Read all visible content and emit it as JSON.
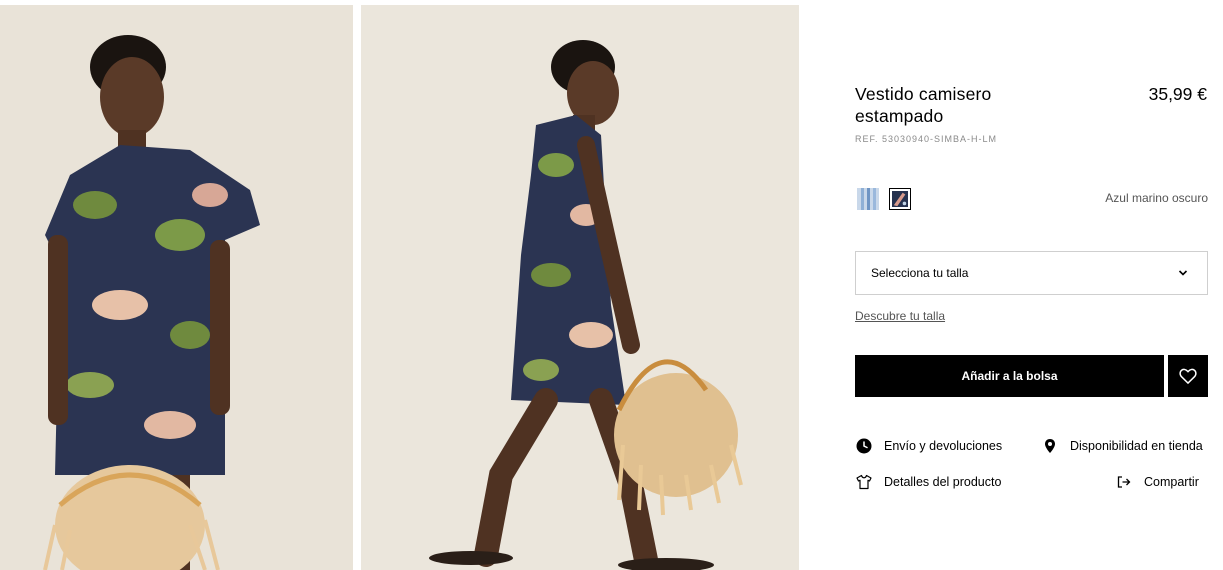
{
  "gallery": {
    "images": [
      {
        "alt": "front-view-photo"
      },
      {
        "alt": "side-view-photo"
      }
    ]
  },
  "product": {
    "title": "Vestido camisero estampado",
    "price": "35,99 €",
    "ref": "REF. 53030940-SIMBA-H-LM"
  },
  "colors": {
    "selected_name": "Azul marino oscuro",
    "swatches": [
      {
        "name": "light-blue-stripe",
        "color": "#8fb0d6"
      },
      {
        "name": "navy-print",
        "color": "#26324f",
        "selected": true
      }
    ]
  },
  "size": {
    "placeholder": "Selecciona tu talla",
    "guide_link": "Descubre tu talla"
  },
  "actions": {
    "add_to_bag": "Añadir a la bolsa",
    "shipping": "Envío y devoluciones",
    "availability": "Disponibilidad en tienda",
    "details": "Detalles del producto",
    "share": "Compartir"
  },
  "icons": {
    "favorite": "heart-icon",
    "shipping": "clock-icon",
    "availability": "location-pin-icon",
    "details": "tshirt-icon",
    "share": "share-icon"
  }
}
